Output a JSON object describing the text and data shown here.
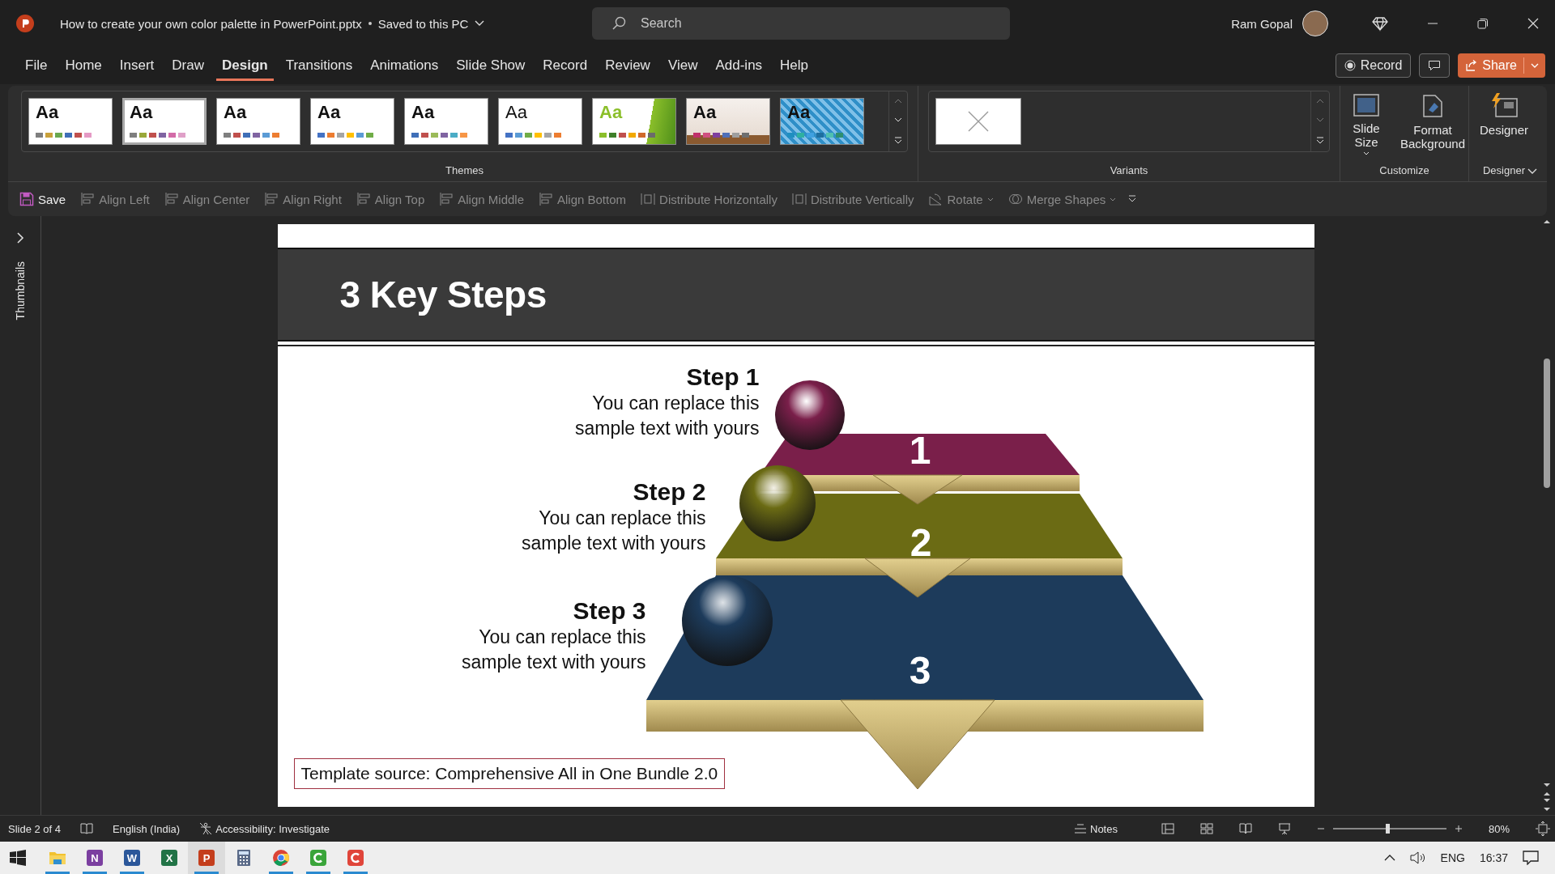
{
  "title_bar": {
    "file_title": "How to create your own color palette in PowerPoint.pptx",
    "save_status": "Saved to this PC",
    "search": {
      "placeholder": "Search"
    },
    "user": "Ram Gopal"
  },
  "tabs": [
    {
      "label": "File",
      "selected": false
    },
    {
      "label": "Home",
      "selected": false
    },
    {
      "label": "Insert",
      "selected": false
    },
    {
      "label": "Draw",
      "selected": false
    },
    {
      "label": "Design",
      "selected": true
    },
    {
      "label": "Transitions",
      "selected": false
    },
    {
      "label": "Animations",
      "selected": false
    },
    {
      "label": "Slide Show",
      "selected": false
    },
    {
      "label": "Record",
      "selected": false
    },
    {
      "label": "Review",
      "selected": false
    },
    {
      "label": "View",
      "selected": false
    },
    {
      "label": "Add-ins",
      "selected": false
    },
    {
      "label": "Help",
      "selected": false
    }
  ],
  "header_buttons": {
    "record": "Record",
    "share": "Share"
  },
  "themes": {
    "label": "Themes",
    "items": [
      {
        "label": "Aa",
        "selected": false,
        "kind": "plain",
        "swatches": [
          {
            "color": "#7f7f7f"
          },
          {
            "color": "#c9a13b"
          },
          {
            "color": "#6aa84f"
          },
          {
            "color": "#3f6fb8"
          },
          {
            "color": "#c0504d"
          },
          {
            "color": "#e59ac5"
          }
        ]
      },
      {
        "label": "Aa",
        "selected": true,
        "kind": "plain",
        "swatches": [
          {
            "color": "#7f7f7f"
          },
          {
            "color": "#9aa83a"
          },
          {
            "color": "#c0504d"
          },
          {
            "color": "#8064a2"
          },
          {
            "color": "#d36ba8"
          },
          {
            "color": "#e0a0c8"
          }
        ]
      },
      {
        "label": "Aa",
        "selected": false,
        "kind": "plain",
        "swatches": [
          {
            "color": "#7f7f7f"
          },
          {
            "color": "#c0504d"
          },
          {
            "color": "#3f6fb8"
          },
          {
            "color": "#8064a2"
          },
          {
            "color": "#5b9bd5"
          },
          {
            "color": "#ed7d31"
          }
        ]
      },
      {
        "label": "Aa",
        "selected": false,
        "kind": "plain",
        "swatches": [
          {
            "color": "#4472c4"
          },
          {
            "color": "#ed7d31"
          },
          {
            "color": "#a5a5a5"
          },
          {
            "color": "#ffc000"
          },
          {
            "color": "#5b9bd5"
          },
          {
            "color": "#70ad47"
          }
        ]
      },
      {
        "label": "Aa",
        "selected": false,
        "kind": "plain",
        "swatches": [
          {
            "color": "#3f6fb8"
          },
          {
            "color": "#c0504d"
          },
          {
            "color": "#9bbb59"
          },
          {
            "color": "#8064a2"
          },
          {
            "color": "#4bacc6"
          },
          {
            "color": "#f79646"
          }
        ]
      },
      {
        "label": "Aa",
        "selected": false,
        "kind": "light",
        "swatches": [
          {
            "color": "#4472c4"
          },
          {
            "color": "#5b9bd5"
          },
          {
            "color": "#70ad47"
          },
          {
            "color": "#ffc000"
          },
          {
            "color": "#a5a5a5"
          },
          {
            "color": "#ed7d31"
          }
        ]
      },
      {
        "label": "Aa",
        "selected": false,
        "kind": "green",
        "swatches": [
          {
            "color": "#8bbf2a"
          },
          {
            "color": "#3f7f2a"
          },
          {
            "color": "#c0504d"
          },
          {
            "color": "#f2a900"
          },
          {
            "color": "#d06a2a"
          },
          {
            "color": "#6b6b6b"
          }
        ]
      },
      {
        "label": "Aa",
        "selected": false,
        "kind": "paper",
        "swatches": [
          {
            "color": "#c0306a"
          },
          {
            "color": "#d05080"
          },
          {
            "color": "#7f3f9f"
          },
          {
            "color": "#4f6fb8"
          },
          {
            "color": "#9f9f9f"
          },
          {
            "color": "#6f6f6f"
          }
        ]
      },
      {
        "label": "Aa",
        "selected": false,
        "kind": "pattern",
        "swatches": [
          {
            "color": "#1f8fc0"
          },
          {
            "color": "#2fb0a0"
          },
          {
            "color": "#3fa0e0"
          },
          {
            "color": "#1f6fa0"
          },
          {
            "color": "#4fc0b0"
          },
          {
            "color": "#2f8f6f"
          }
        ]
      }
    ]
  },
  "variants": {
    "label": "Variants"
  },
  "customize": {
    "label": "Customize",
    "buttons": [
      {
        "label": "Slide Size",
        "has_menu": true
      },
      {
        "label": "Format Background",
        "has_menu": false
      }
    ]
  },
  "designer": {
    "label": "Designer",
    "button": "Designer"
  },
  "quick_access": [
    {
      "label": "Save",
      "kind": "save",
      "disabled": false,
      "has_menu": false
    },
    {
      "label": "Align Left",
      "kind": "align",
      "disabled": true,
      "has_menu": false
    },
    {
      "label": "Align Center",
      "kind": "align",
      "disabled": true,
      "has_menu": false
    },
    {
      "label": "Align Right",
      "kind": "align",
      "disabled": true,
      "has_menu": false
    },
    {
      "label": "Align Top",
      "kind": "align",
      "disabled": true,
      "has_menu": false
    },
    {
      "label": "Align Middle",
      "kind": "align",
      "disabled": true,
      "has_menu": false
    },
    {
      "label": "Align Bottom",
      "kind": "align",
      "disabled": true,
      "has_menu": false
    },
    {
      "label": "Distribute Horizontally",
      "kind": "distribute",
      "disabled": true,
      "has_menu": false
    },
    {
      "label": "Distribute Vertically",
      "kind": "distribute",
      "disabled": true,
      "has_menu": false
    },
    {
      "label": "Rotate",
      "kind": "rotate",
      "disabled": true,
      "has_menu": true
    },
    {
      "label": "Merge Shapes",
      "kind": "merge",
      "disabled": true,
      "has_menu": true
    }
  ],
  "thumbnails_pane": {
    "label": "Thumbnails",
    "expanded": false
  },
  "slide": {
    "title": "3 Key Steps",
    "steps": [
      {
        "title": "Step 1",
        "text": "You can replace this sample text with yours",
        "number": "1",
        "color": "#7a1f4a"
      },
      {
        "title": "Step 2",
        "text": "You can replace this sample text with yours",
        "number": "2",
        "color": "#6b6b14"
      },
      {
        "title": "Step 3",
        "text": "You can replace this sample text with yours",
        "number": "3",
        "color": "#1d3b5b"
      }
    ],
    "source": "Template source: Comprehensive All in One Bundle 2.0"
  },
  "status_bar": {
    "slide": "Slide 2 of 4",
    "language": "English (India)",
    "accessibility": "Accessibility: Investigate",
    "notes": "Notes",
    "zoom": "80%",
    "zoom_slider": {
      "level": 0.5
    }
  },
  "taskbar": {
    "apps": [
      {
        "kind": "folder",
        "running": true,
        "selected": false
      },
      {
        "kind": "tile",
        "glyph": "N",
        "color": "#7b3fa0",
        "running": true,
        "selected": false
      },
      {
        "kind": "tile",
        "glyph": "W",
        "color": "#2b579a",
        "running": true,
        "selected": false
      },
      {
        "kind": "tile",
        "glyph": "X",
        "color": "#217346",
        "running": false,
        "selected": false
      },
      {
        "kind": "tile",
        "glyph": "P",
        "color": "#c43e1c",
        "running": true,
        "selected": true
      },
      {
        "kind": "calculator",
        "running": false,
        "selected": false
      },
      {
        "kind": "chrome",
        "running": true,
        "selected": false
      },
      {
        "kind": "c-logo",
        "color": "#3aa53a",
        "running": true,
        "selected": false
      },
      {
        "kind": "c-logo",
        "color": "#e0453a",
        "running": true,
        "selected": false
      }
    ],
    "language": "ENG",
    "time": "16:37"
  }
}
